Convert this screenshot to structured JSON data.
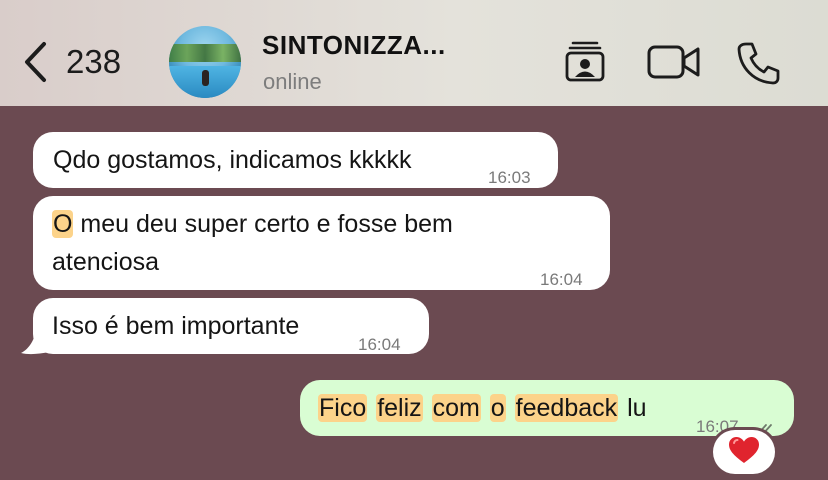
{
  "header": {
    "back_count": "238",
    "contact_name": "SINTONIZZA...",
    "status": "online"
  },
  "messages": [
    {
      "text": "Qdo gostamos, indicamos kkkkk",
      "time": "16:03"
    },
    {
      "text_parts": [
        "O",
        " meu deu super certo e fosse bem",
        "atenciosa"
      ],
      "time": "16:04"
    },
    {
      "text": "Isso é bem importante",
      "time": "16:04"
    },
    {
      "words": [
        "Fico",
        "feliz",
        "com",
        "o",
        "feedback",
        "lu"
      ],
      "time": "16:07"
    }
  ],
  "reaction": "❤️",
  "colors": {
    "chat_background": "#6b4a51",
    "incoming_bubble": "#ffffff",
    "outgoing_bubble": "#d9fdd3",
    "highlight": "#fcd38a"
  },
  "icons": [
    "back-chevron-icon",
    "contact-card-icon",
    "video-call-icon",
    "phone-icon",
    "double-check-icon",
    "heart-icon"
  ]
}
